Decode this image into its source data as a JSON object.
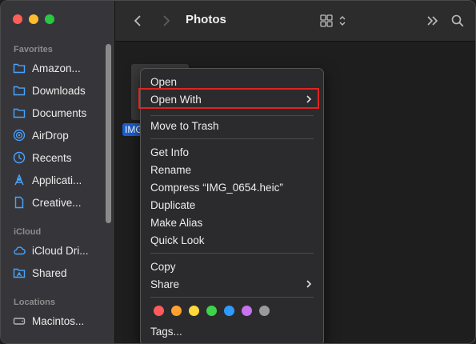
{
  "window": {
    "title": "Photos"
  },
  "sidebar": {
    "sections": [
      {
        "title": "Favorites",
        "items": [
          {
            "label": "Amazon...",
            "icon": "folder-icon"
          },
          {
            "label": "Downloads",
            "icon": "folder-icon"
          },
          {
            "label": "Documents",
            "icon": "folder-icon"
          },
          {
            "label": "AirDrop",
            "icon": "airdrop-icon"
          },
          {
            "label": "Recents",
            "icon": "clock-icon"
          },
          {
            "label": "Applicati...",
            "icon": "applications-icon"
          },
          {
            "label": "Creative...",
            "icon": "document-icon"
          }
        ]
      },
      {
        "title": "iCloud",
        "items": [
          {
            "label": "iCloud Dri...",
            "icon": "cloud-icon"
          },
          {
            "label": "Shared",
            "icon": "shared-folder-icon"
          }
        ]
      },
      {
        "title": "Locations",
        "items": [
          {
            "label": "Macintos...",
            "icon": "disk-icon"
          }
        ]
      }
    ]
  },
  "content": {
    "file_label": "IMG"
  },
  "context_menu": {
    "items": [
      {
        "label": "Open"
      },
      {
        "label": "Open With",
        "submenu": true
      },
      {
        "label": "Move to Trash"
      },
      {
        "label": "Get Info"
      },
      {
        "label": "Rename"
      },
      {
        "label": "Compress “IMG_0654.heic”"
      },
      {
        "label": "Duplicate"
      },
      {
        "label": "Make Alias"
      },
      {
        "label": "Quick Look"
      },
      {
        "label": "Copy"
      },
      {
        "label": "Share",
        "submenu": true
      },
      {
        "label": "Tags..."
      }
    ],
    "tag_colors": [
      "#ff5b5b",
      "#ffa12e",
      "#ffd83b",
      "#3ed34a",
      "#2e9bff",
      "#c872f0",
      "#9a9a9a"
    ],
    "highlight_color": "#e0231f"
  }
}
